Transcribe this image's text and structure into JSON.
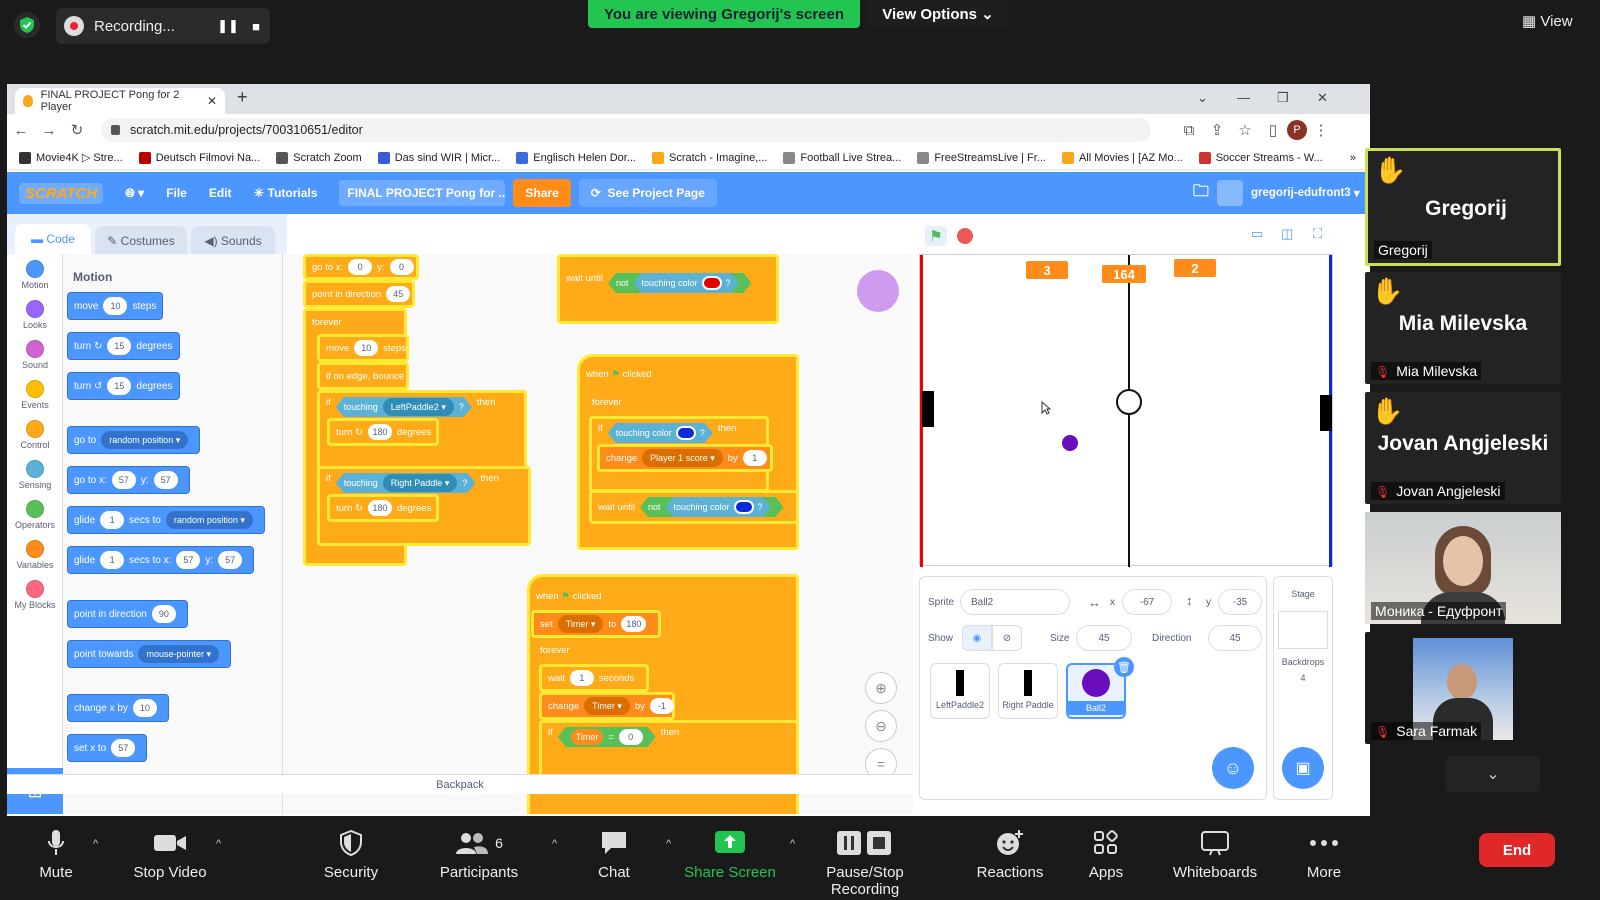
{
  "zoom": {
    "recording_label": "Recording...",
    "viewing_banner": "You are viewing Gregorij's screen",
    "view_options": "View Options ⌄",
    "view_label": "View",
    "end_label": "End",
    "toolbar": [
      {
        "label": "Mute",
        "icon": "microphone-icon"
      },
      {
        "label": "Stop Video",
        "icon": "video-camera-icon"
      },
      {
        "label": "Security",
        "icon": "shield-icon"
      },
      {
        "label": "Participants",
        "icon": "people-icon",
        "count": "6"
      },
      {
        "label": "Chat",
        "icon": "chat-bubble-icon"
      },
      {
        "label": "Share Screen",
        "icon": "share-screen-icon"
      },
      {
        "label": "Pause/Stop Recording",
        "icon": "pause-stop-icon"
      },
      {
        "label": "Reactions",
        "icon": "smiley-plus-icon"
      },
      {
        "label": "Apps",
        "icon": "apps-icon"
      },
      {
        "label": "Whiteboards",
        "icon": "whiteboard-icon"
      },
      {
        "label": "More",
        "icon": "more-dots-icon"
      }
    ],
    "participants": [
      {
        "name": "Gregorij",
        "big": "Gregorij",
        "hand": true,
        "muted": false
      },
      {
        "name": "Mia Milevska",
        "big": "Mia Milevska",
        "hand": true,
        "muted": true
      },
      {
        "name": "Jovan Angjeleski",
        "big": "Jovan Angjeleski",
        "hand": true,
        "muted": true
      },
      {
        "name": "Моника - Едуфронт",
        "hand": false,
        "muted": false
      },
      {
        "name": "Sara Farmak",
        "hand": false,
        "muted": true
      }
    ]
  },
  "browser": {
    "tab_title": "FINAL PROJECT Pong for 2 Player",
    "url": "scratch.mit.edu/projects/700310651/editor",
    "profile_letter": "P",
    "bookmarks": [
      "Movie4K ▷ Stre...",
      "Deutsch Filmovi Na...",
      "Scratch Zoom",
      "Das sind WIR | Micr...",
      "Englisch Helen Dor...",
      "Scratch - Imagine,...",
      "Football Live Strea...",
      "FreeStreamsLive | Fr...",
      "All Movies | [AZ Mo...",
      "Soccer Streams - W..."
    ]
  },
  "scratch": {
    "logo": "SCRATCH",
    "menu": {
      "file": "File",
      "edit": "Edit",
      "tutorials": "Tutorials",
      "project_title": "FINAL PROJECT Pong for ...",
      "share": "Share",
      "see_project": "See Project Page",
      "user": "gregorij-edufront3"
    },
    "tabs": {
      "code": "Code",
      "costumes": "Costumes",
      "sounds": "Sounds"
    },
    "categories": [
      {
        "label": "Motion",
        "color": "#4c97ff"
      },
      {
        "label": "Looks",
        "color": "#9966ff"
      },
      {
        "label": "Sound",
        "color": "#cf63cf"
      },
      {
        "label": "Events",
        "color": "#ffbf00"
      },
      {
        "label": "Control",
        "color": "#ffab19"
      },
      {
        "label": "Sensing",
        "color": "#5cb1d6"
      },
      {
        "label": "Operators",
        "color": "#59c059"
      },
      {
        "label": "Variables",
        "color": "#ff8c1a"
      },
      {
        "label": "My Blocks",
        "color": "#ff6680"
      }
    ],
    "palette_heading": "Motion",
    "palette": {
      "move": {
        "a": "move",
        "v": "10",
        "b": "steps"
      },
      "turn_r": {
        "a": "turn",
        "v": "15",
        "b": "degrees"
      },
      "turn_l": {
        "a": "turn",
        "v": "15",
        "b": "degrees"
      },
      "goto": {
        "a": "go to",
        "d": "random position"
      },
      "gotoxy": {
        "a": "go to x:",
        "x": "57",
        "y_label": "y:",
        "y": "57"
      },
      "glide1": {
        "a": "glide",
        "v": "1",
        "b": "secs to",
        "d": "random position"
      },
      "glide2": {
        "a": "glide",
        "v": "1",
        "b": "secs to x:",
        "x": "57",
        "y_label": "y:",
        "y": "57"
      },
      "pointdir": {
        "a": "point in direction",
        "v": "90"
      },
      "pointtow": {
        "a": "point towards",
        "d": "mouse-pointer"
      },
      "changex": {
        "a": "change x by",
        "v": "10"
      },
      "setx": {
        "a": "set x to",
        "v": "57"
      }
    },
    "script": {
      "s1_goto": {
        "a": "go to x:",
        "x": "0",
        "y_label": "y:",
        "y": "0"
      },
      "s1_point": {
        "a": "point in direction",
        "v": "45"
      },
      "s1_forever": "forever",
      "s1_move": {
        "a": "move",
        "v": "10",
        "b": "steps"
      },
      "s1_bounce": "if on edge, bounce",
      "s1_if1": {
        "a": "if",
        "c1": "touching",
        "d": "LeftPaddle2",
        "q": "?",
        "b": "then"
      },
      "s1_turn1": {
        "a": "turn",
        "v": "180",
        "b": "degrees"
      },
      "s1_if2": {
        "a": "if",
        "c1": "touching",
        "d": "Right Paddle",
        "q": "?",
        "b": "then"
      },
      "s1_turn2": {
        "a": "turn",
        "v": "180",
        "b": "degrees"
      },
      "s2_wait": {
        "a": "wait until",
        "n": "not",
        "c": "touching color",
        "q": "?",
        "color": "#e00000"
      },
      "s3_hat": {
        "a": "when",
        "b": "clicked"
      },
      "s3_forever": "forever",
      "s3_if": {
        "a": "if",
        "c": "touching color",
        "q": "?",
        "b": "then",
        "color": "#0a2bd8"
      },
      "s3_change": {
        "a": "change",
        "d": "Player 1 score",
        "b": "by",
        "v": "1"
      },
      "s3_wait": {
        "a": "wait until",
        "n": "not",
        "c": "touching color",
        "q": "?",
        "color": "#0a2bd8"
      },
      "s4_hat": {
        "a": "when",
        "b": "clicked"
      },
      "s4_set": {
        "a": "set",
        "d": "Timer",
        "b": "to",
        "v": "180"
      },
      "s4_forever": "forever",
      "s4_wait": {
        "a": "wait",
        "v": "1",
        "b": "seconds"
      },
      "s4_change": {
        "a": "change",
        "d": "Timer",
        "b": "by",
        "v": "-1"
      },
      "s4_if": {
        "a": "if",
        "d": "Timer",
        "eq": "=",
        "v": "0",
        "b": "then"
      }
    },
    "backpack": "Backpack",
    "stage": {
      "score_left": "3",
      "timer": "164",
      "score_right": "2"
    },
    "sprite": {
      "sprite_label": "Sprite",
      "name": "Ball2",
      "x_label": "x",
      "x": "-67",
      "y_label": "y",
      "y": "-35",
      "show_label": "Show",
      "size_label": "Size",
      "size": "45",
      "direction_label": "Direction",
      "direction": "45",
      "thumbs": [
        {
          "label": "LeftPaddle2"
        },
        {
          "label": "Right Paddle"
        },
        {
          "label": "Ball2"
        }
      ]
    },
    "stage_panel": {
      "title": "Stage",
      "backdrops_label": "Backdrops",
      "backdrops": "4"
    }
  }
}
